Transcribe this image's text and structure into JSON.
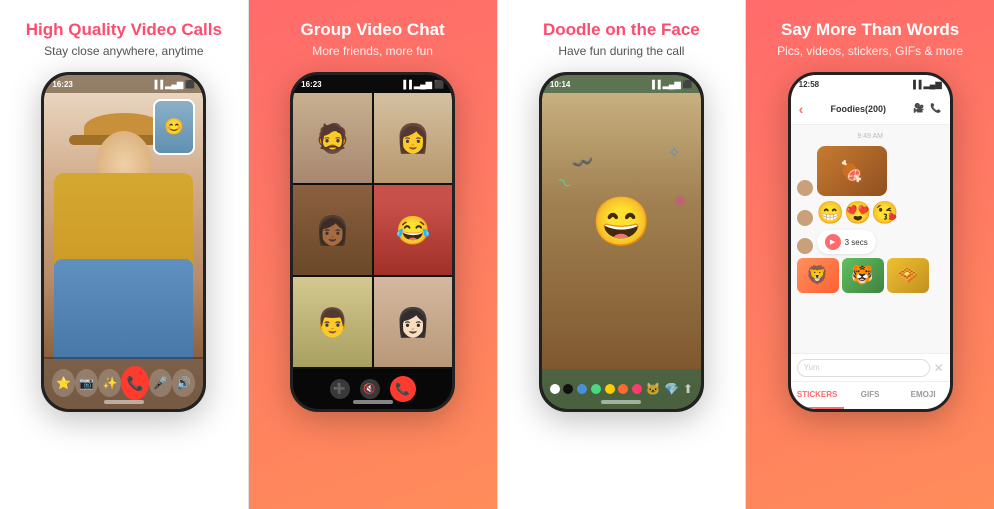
{
  "panels": [
    {
      "id": "panel-1",
      "title": "High Quality Video Calls",
      "subtitle": "Stay close anywhere, anytime",
      "status_time": "16:23",
      "bg": "white"
    },
    {
      "id": "panel-2",
      "title": "Group Video Chat",
      "subtitle": "More friends, more fun",
      "status_time": "16:23",
      "bg": "coral"
    },
    {
      "id": "panel-3",
      "title": "Doodle on the Face",
      "subtitle": "Have fun during the call",
      "status_time": "10:14",
      "bg": "white"
    },
    {
      "id": "panel-4",
      "title": "Say More Than Words",
      "subtitle": "Pics, videos, stickers, GIFs & more",
      "status_time": "12:58",
      "bg": "coral",
      "chat": {
        "group_name": "Foodies(200)",
        "input_placeholder": "Yum",
        "tabs": [
          "STICKERS",
          "GIFS",
          "EMOJI"
        ],
        "timestamp": "9:49 AM",
        "voice_label": "3 secs"
      }
    }
  ],
  "controls": {
    "end_call": "📞",
    "star": "⭐",
    "camera": "📷",
    "mic_off": "🎤",
    "volume": "🔊"
  }
}
